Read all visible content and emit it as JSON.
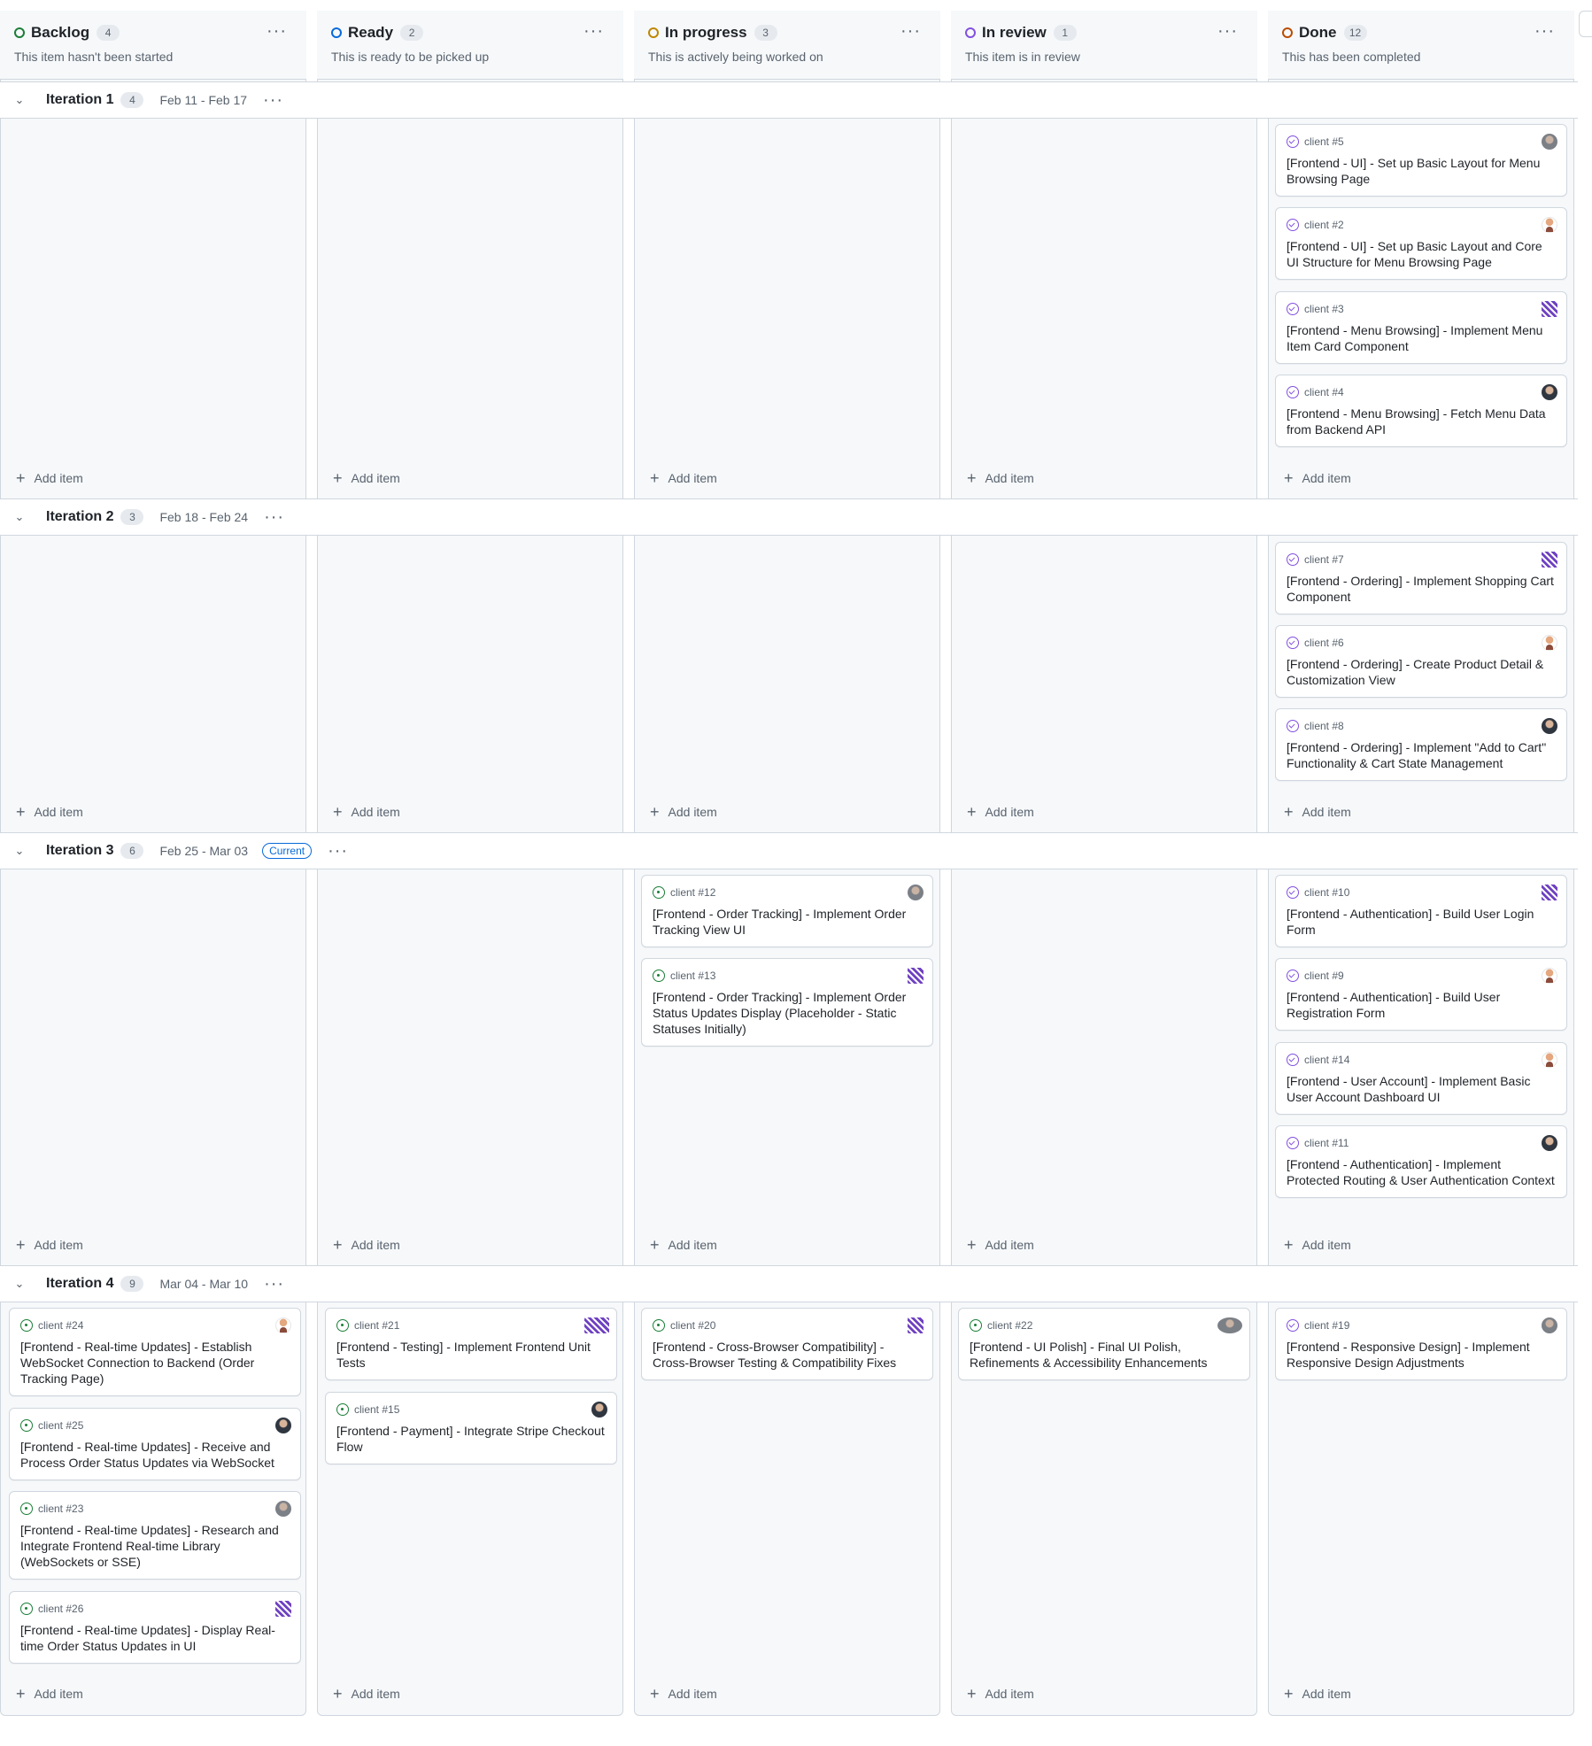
{
  "columns": [
    {
      "title": "Backlog",
      "count": "4",
      "desc": "This item hasn't been started",
      "color": "#1a7f37"
    },
    {
      "title": "Ready",
      "count": "2",
      "desc": "This is ready to be picked up",
      "color": "#0969da"
    },
    {
      "title": "In progress",
      "count": "3",
      "desc": "This is actively being worked on",
      "color": "#bf8700"
    },
    {
      "title": "In review",
      "count": "1",
      "desc": "This item is in review",
      "color": "#8250df"
    },
    {
      "title": "Done",
      "count": "12",
      "desc": "This has been completed",
      "color": "#bc4c00"
    }
  ],
  "iterations": [
    {
      "title": "Iteration 1",
      "count": "4",
      "dates": "Feb 11 - Feb 17",
      "current": ""
    },
    {
      "title": "Iteration 2",
      "count": "3",
      "dates": "Feb 18 - Feb 24",
      "current": ""
    },
    {
      "title": "Iteration 3",
      "count": "6",
      "dates": "Feb 25 - Mar 03",
      "current": "Current"
    },
    {
      "title": "Iteration 4",
      "count": "9",
      "dates": "Mar 04 - Mar 10",
      "current": ""
    }
  ],
  "add_item_label": "Add item",
  "cards": [
    {
      "ref": "client #5",
      "title": "[Frontend - UI] - Set up Basic Layout for Menu Browsing Page",
      "state": "closed",
      "avatar": "grey"
    },
    {
      "ref": "client #2",
      "title": "[Frontend - UI] - Set up Basic Layout and Core UI Structure for Menu Browsing Page",
      "state": "closed",
      "avatar": "person"
    },
    {
      "ref": "client #3",
      "title": "[Frontend - Menu Browsing] - Implement Menu Item Card Component",
      "state": "closed",
      "avatar": "pixel"
    },
    {
      "ref": "client #4",
      "title": "[Frontend - Menu Browsing] - Fetch Menu Data from Backend API",
      "state": "closed",
      "avatar": "dark"
    },
    {
      "ref": "client #7",
      "title": "[Frontend - Ordering] - Implement Shopping Cart Component",
      "state": "closed",
      "avatar": "pixel"
    },
    {
      "ref": "client #6",
      "title": "[Frontend - Ordering] - Create Product Detail & Customization View",
      "state": "closed",
      "avatar": "person"
    },
    {
      "ref": "client #8",
      "title": "[Frontend - Ordering] - Implement \"Add to Cart\" Functionality & Cart State Management",
      "state": "closed",
      "avatar": "dark"
    },
    {
      "ref": "client #12",
      "title": "[Frontend - Order Tracking] - Implement Order Tracking View UI",
      "state": "open",
      "avatar": "grey"
    },
    {
      "ref": "client #13",
      "title": "[Frontend - Order Tracking] - Implement Order Status Updates Display (Placeholder - Static Statuses Initially)",
      "state": "open",
      "avatar": "pixel"
    },
    {
      "ref": "client #10",
      "title": "[Frontend - Authentication] - Build User Login Form",
      "state": "closed",
      "avatar": "pixel"
    },
    {
      "ref": "client #9",
      "title": "[Frontend - Authentication] - Build User Registration Form",
      "state": "closed",
      "avatar": "person"
    },
    {
      "ref": "client #14",
      "title": "[Frontend - User Account] - Implement Basic User Account Dashboard UI",
      "state": "closed",
      "avatar": "person"
    },
    {
      "ref": "client #11",
      "title": "[Frontend - Authentication] - Implement Protected Routing & User Authentication Context",
      "state": "closed",
      "avatar": "dark"
    },
    {
      "ref": "client #24",
      "title": "[Frontend - Real-time Updates] - Establish WebSocket Connection to Backend (Order Tracking Page)",
      "state": "open",
      "avatar": "person"
    },
    {
      "ref": "client #25",
      "title": "[Frontend - Real-time Updates] - Receive and Process Order Status Updates via WebSocket",
      "state": "open",
      "avatar": "dark"
    },
    {
      "ref": "client #23",
      "title": "[Frontend - Real-time Updates] - Research and Integrate Frontend Real-time Library (WebSockets or SSE)",
      "state": "open",
      "avatar": "grey"
    },
    {
      "ref": "client #26",
      "title": "[Frontend - Real-time Updates] - Display Real-time Order Status Updates in UI",
      "state": "open",
      "avatar": "pixel"
    },
    {
      "ref": "client #21",
      "title": "[Frontend - Testing] - Implement Frontend Unit Tests",
      "state": "open",
      "avatar": "pair"
    },
    {
      "ref": "client #15",
      "title": "[Frontend - Payment] - Integrate Stripe Checkout Flow",
      "state": "open",
      "avatar": "dark"
    },
    {
      "ref": "client #20",
      "title": "[Frontend - Cross-Browser Compatibility] - Cross-Browser Testing & Compatibility Fixes",
      "state": "open",
      "avatar": "pixel"
    },
    {
      "ref": "client #22",
      "title": "[Frontend - UI Polish] - Final UI Polish, Refinements & Accessibility Enhancements",
      "state": "open",
      "avatar": "pair"
    },
    {
      "ref": "client #19",
      "title": "[Frontend - Responsive Design] - Implement Responsive Design Adjustments",
      "state": "closed",
      "avatar": "grey"
    }
  ]
}
